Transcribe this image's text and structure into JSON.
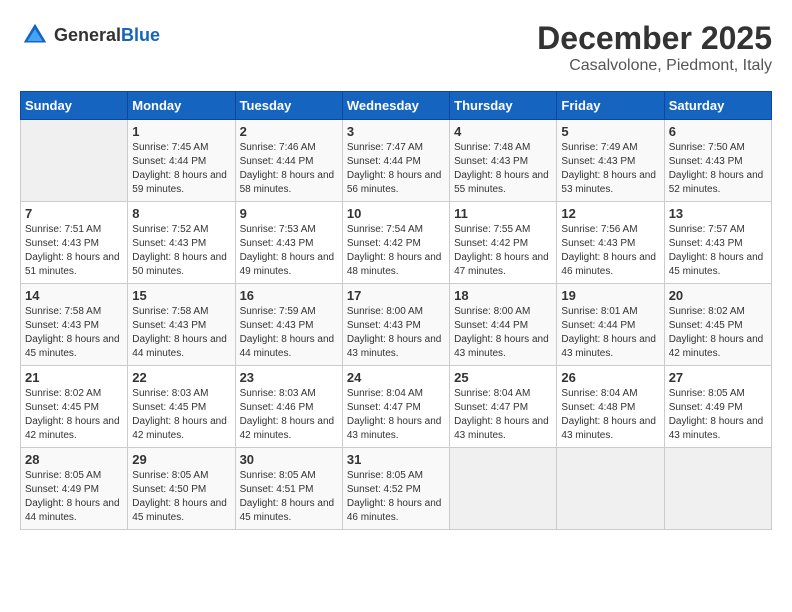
{
  "header": {
    "logo_general": "General",
    "logo_blue": "Blue",
    "month_title": "December 2025",
    "location": "Casalvolone, Piedmont, Italy"
  },
  "weekdays": [
    "Sunday",
    "Monday",
    "Tuesday",
    "Wednesday",
    "Thursday",
    "Friday",
    "Saturday"
  ],
  "weeks": [
    [
      {
        "day": "",
        "sunrise": "",
        "sunset": "",
        "daylight": ""
      },
      {
        "day": "1",
        "sunrise": "Sunrise: 7:45 AM",
        "sunset": "Sunset: 4:44 PM",
        "daylight": "Daylight: 8 hours and 59 minutes."
      },
      {
        "day": "2",
        "sunrise": "Sunrise: 7:46 AM",
        "sunset": "Sunset: 4:44 PM",
        "daylight": "Daylight: 8 hours and 58 minutes."
      },
      {
        "day": "3",
        "sunrise": "Sunrise: 7:47 AM",
        "sunset": "Sunset: 4:44 PM",
        "daylight": "Daylight: 8 hours and 56 minutes."
      },
      {
        "day": "4",
        "sunrise": "Sunrise: 7:48 AM",
        "sunset": "Sunset: 4:43 PM",
        "daylight": "Daylight: 8 hours and 55 minutes."
      },
      {
        "day": "5",
        "sunrise": "Sunrise: 7:49 AM",
        "sunset": "Sunset: 4:43 PM",
        "daylight": "Daylight: 8 hours and 53 minutes."
      },
      {
        "day": "6",
        "sunrise": "Sunrise: 7:50 AM",
        "sunset": "Sunset: 4:43 PM",
        "daylight": "Daylight: 8 hours and 52 minutes."
      }
    ],
    [
      {
        "day": "7",
        "sunrise": "Sunrise: 7:51 AM",
        "sunset": "Sunset: 4:43 PM",
        "daylight": "Daylight: 8 hours and 51 minutes."
      },
      {
        "day": "8",
        "sunrise": "Sunrise: 7:52 AM",
        "sunset": "Sunset: 4:43 PM",
        "daylight": "Daylight: 8 hours and 50 minutes."
      },
      {
        "day": "9",
        "sunrise": "Sunrise: 7:53 AM",
        "sunset": "Sunset: 4:43 PM",
        "daylight": "Daylight: 8 hours and 49 minutes."
      },
      {
        "day": "10",
        "sunrise": "Sunrise: 7:54 AM",
        "sunset": "Sunset: 4:42 PM",
        "daylight": "Daylight: 8 hours and 48 minutes."
      },
      {
        "day": "11",
        "sunrise": "Sunrise: 7:55 AM",
        "sunset": "Sunset: 4:42 PM",
        "daylight": "Daylight: 8 hours and 47 minutes."
      },
      {
        "day": "12",
        "sunrise": "Sunrise: 7:56 AM",
        "sunset": "Sunset: 4:43 PM",
        "daylight": "Daylight: 8 hours and 46 minutes."
      },
      {
        "day": "13",
        "sunrise": "Sunrise: 7:57 AM",
        "sunset": "Sunset: 4:43 PM",
        "daylight": "Daylight: 8 hours and 45 minutes."
      }
    ],
    [
      {
        "day": "14",
        "sunrise": "Sunrise: 7:58 AM",
        "sunset": "Sunset: 4:43 PM",
        "daylight": "Daylight: 8 hours and 45 minutes."
      },
      {
        "day": "15",
        "sunrise": "Sunrise: 7:58 AM",
        "sunset": "Sunset: 4:43 PM",
        "daylight": "Daylight: 8 hours and 44 minutes."
      },
      {
        "day": "16",
        "sunrise": "Sunrise: 7:59 AM",
        "sunset": "Sunset: 4:43 PM",
        "daylight": "Daylight: 8 hours and 44 minutes."
      },
      {
        "day": "17",
        "sunrise": "Sunrise: 8:00 AM",
        "sunset": "Sunset: 4:43 PM",
        "daylight": "Daylight: 8 hours and 43 minutes."
      },
      {
        "day": "18",
        "sunrise": "Sunrise: 8:00 AM",
        "sunset": "Sunset: 4:44 PM",
        "daylight": "Daylight: 8 hours and 43 minutes."
      },
      {
        "day": "19",
        "sunrise": "Sunrise: 8:01 AM",
        "sunset": "Sunset: 4:44 PM",
        "daylight": "Daylight: 8 hours and 43 minutes."
      },
      {
        "day": "20",
        "sunrise": "Sunrise: 8:02 AM",
        "sunset": "Sunset: 4:45 PM",
        "daylight": "Daylight: 8 hours and 42 minutes."
      }
    ],
    [
      {
        "day": "21",
        "sunrise": "Sunrise: 8:02 AM",
        "sunset": "Sunset: 4:45 PM",
        "daylight": "Daylight: 8 hours and 42 minutes."
      },
      {
        "day": "22",
        "sunrise": "Sunrise: 8:03 AM",
        "sunset": "Sunset: 4:45 PM",
        "daylight": "Daylight: 8 hours and 42 minutes."
      },
      {
        "day": "23",
        "sunrise": "Sunrise: 8:03 AM",
        "sunset": "Sunset: 4:46 PM",
        "daylight": "Daylight: 8 hours and 42 minutes."
      },
      {
        "day": "24",
        "sunrise": "Sunrise: 8:04 AM",
        "sunset": "Sunset: 4:47 PM",
        "daylight": "Daylight: 8 hours and 43 minutes."
      },
      {
        "day": "25",
        "sunrise": "Sunrise: 8:04 AM",
        "sunset": "Sunset: 4:47 PM",
        "daylight": "Daylight: 8 hours and 43 minutes."
      },
      {
        "day": "26",
        "sunrise": "Sunrise: 8:04 AM",
        "sunset": "Sunset: 4:48 PM",
        "daylight": "Daylight: 8 hours and 43 minutes."
      },
      {
        "day": "27",
        "sunrise": "Sunrise: 8:05 AM",
        "sunset": "Sunset: 4:49 PM",
        "daylight": "Daylight: 8 hours and 43 minutes."
      }
    ],
    [
      {
        "day": "28",
        "sunrise": "Sunrise: 8:05 AM",
        "sunset": "Sunset: 4:49 PM",
        "daylight": "Daylight: 8 hours and 44 minutes."
      },
      {
        "day": "29",
        "sunrise": "Sunrise: 8:05 AM",
        "sunset": "Sunset: 4:50 PM",
        "daylight": "Daylight: 8 hours and 45 minutes."
      },
      {
        "day": "30",
        "sunrise": "Sunrise: 8:05 AM",
        "sunset": "Sunset: 4:51 PM",
        "daylight": "Daylight: 8 hours and 45 minutes."
      },
      {
        "day": "31",
        "sunrise": "Sunrise: 8:05 AM",
        "sunset": "Sunset: 4:52 PM",
        "daylight": "Daylight: 8 hours and 46 minutes."
      },
      {
        "day": "",
        "sunrise": "",
        "sunset": "",
        "daylight": ""
      },
      {
        "day": "",
        "sunrise": "",
        "sunset": "",
        "daylight": ""
      },
      {
        "day": "",
        "sunrise": "",
        "sunset": "",
        "daylight": ""
      }
    ]
  ]
}
